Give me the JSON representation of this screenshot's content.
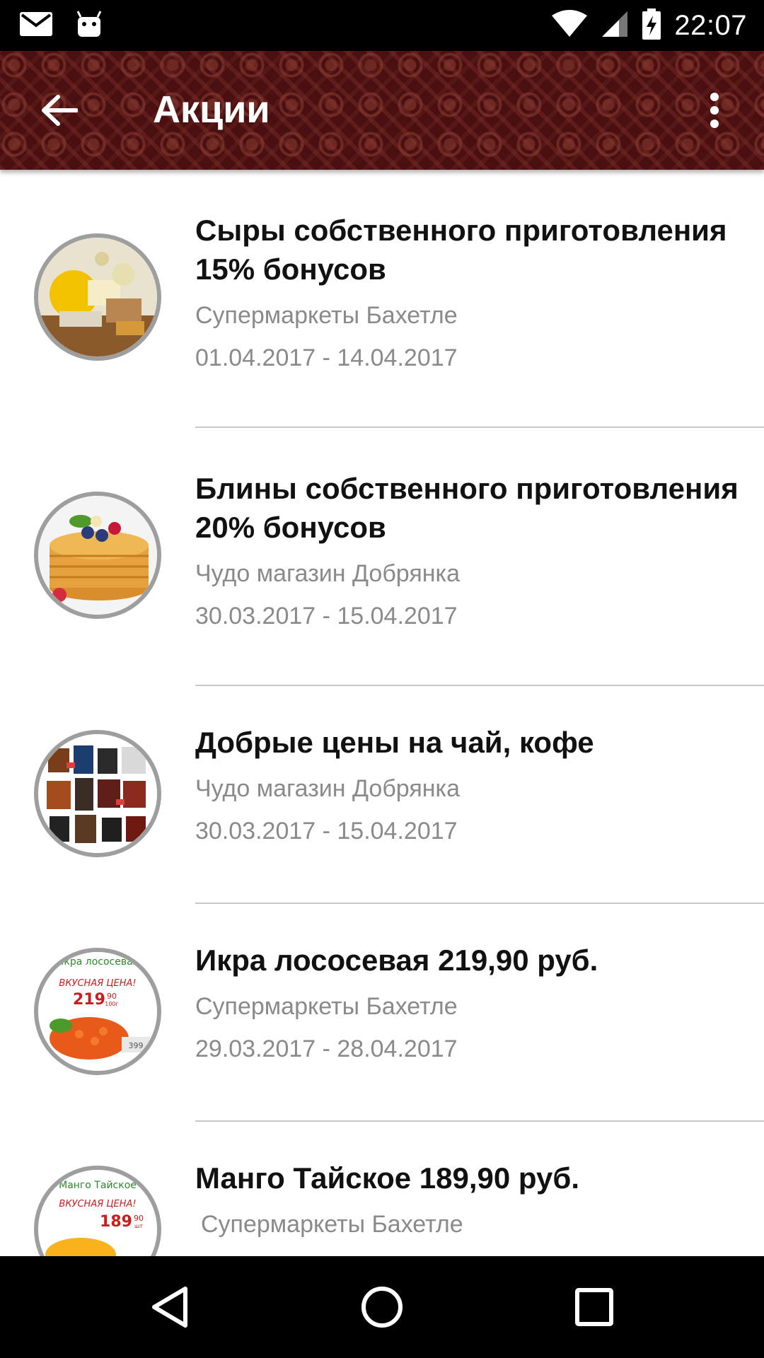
{
  "status_bar": {
    "time": "22:07",
    "icons": [
      "mail-icon",
      "android-icon",
      "wifi-icon",
      "signal-icon",
      "battery-charging-icon"
    ]
  },
  "app_bar": {
    "title": "Акции",
    "back_icon": "arrow-back-icon",
    "menu_icon": "more-vert-icon",
    "background_color": "#4a0f10"
  },
  "promotions": [
    {
      "title": "Сыры собственного приготовления 15% бонусов",
      "store": "Супермаркеты Бахетле",
      "dates": "01.04.2017 - 14.04.2017",
      "image": "cheese-image"
    },
    {
      "title": "Блины собственного приготовления 20% бонусов",
      "store": "Чудо магазин Добрянка",
      "dates": "30.03.2017 - 15.04.2017",
      "image": "pancakes-image"
    },
    {
      "title": "Добрые цены на чай, кофе",
      "store": "Чудо магазин Добрянка",
      "dates": "30.03.2017 - 15.04.2017",
      "image": "tea-coffee-image"
    },
    {
      "title": "Икра лососевая 219,90 руб.",
      "store": "Супермаркеты Бахетле",
      "dates": "29.03.2017 - 28.04.2017",
      "image": "caviar-image",
      "image_text": {
        "name": "Икра лососевая",
        "tag": "ВКУСНАЯ ЦЕНА!",
        "price": "219",
        "price_cents": "90",
        "unit": "100г",
        "old_price": "399"
      }
    },
    {
      "title": "Манго Тайское 189,90 руб.",
      "store": "Супермаркеты Бахетле",
      "dates": "",
      "image": "mango-image",
      "image_text": {
        "name": "Манго Тайское",
        "tag": "ВКУСНАЯ ЦЕНА!",
        "price": "189",
        "price_cents": "90",
        "unit": "шт"
      }
    }
  ],
  "nav_bar": {
    "buttons": [
      "back-triangle-icon",
      "home-circle-icon",
      "recents-square-icon"
    ]
  }
}
